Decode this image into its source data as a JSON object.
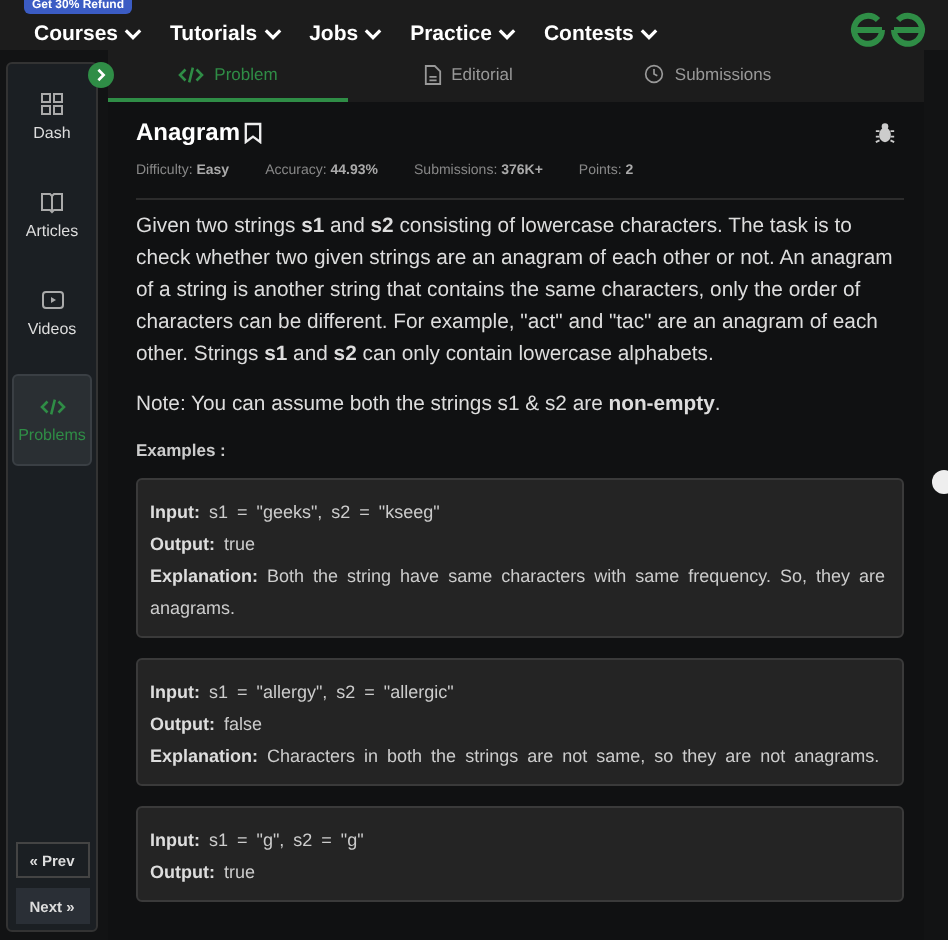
{
  "promo_badge": "Get 30% Refund",
  "nav": [
    {
      "label": "Courses"
    },
    {
      "label": "Tutorials"
    },
    {
      "label": "Jobs"
    },
    {
      "label": "Practice"
    },
    {
      "label": "Contests"
    }
  ],
  "sidebar": {
    "items": [
      {
        "label": "Dash",
        "selected": false
      },
      {
        "label": "Articles",
        "selected": false
      },
      {
        "label": "Videos",
        "selected": false
      },
      {
        "label": "Problems",
        "selected": true
      }
    ],
    "prev": "« Prev",
    "next": "Next »"
  },
  "tabs": [
    {
      "label": "Problem",
      "selected": true
    },
    {
      "label": "Editorial",
      "selected": false
    },
    {
      "label": "Submissions",
      "selected": false
    }
  ],
  "problem": {
    "title": "Anagram",
    "meta": [
      {
        "label": "Difficulty:",
        "value": "Easy"
      },
      {
        "label": "Accuracy:",
        "value": "44.93%"
      },
      {
        "label": "Submissions:",
        "value": "376K+"
      },
      {
        "label": "Points:",
        "value": "2"
      }
    ],
    "description": "Given two strings **s1** and **s2** consisting of lowercase characters. The task is to check whether two given strings are an anagram of each other or not. An anagram of a string is another string that contains the same characters, only the order of characters can be different. For example, \"act\" and \"tac\" are an anagram of each other. Strings **s1** and **s2** can only contain lowercase alphabets.",
    "note": "Note: You can assume both the strings s1 & s2 are **non-empty**.",
    "examples_heading": "Examples :",
    "examples": [
      [
        "**Input:** s1 = \"geeks\", s2 = \"kseeg\"",
        "**Output:** true",
        "**Explanation:** Both the string have same characters with same frequency. So, they are anagrams."
      ],
      [
        "**Input:** s1 = \"allergy\", s2 = \"allergic\"",
        "**Output:** false",
        "**Explanation:** Characters in both the strings are not same, so they are not anagrams."
      ],
      [
        "**Input:** s1 = \"g\", s2 = \"g\"",
        "**Output:** true"
      ]
    ]
  }
}
